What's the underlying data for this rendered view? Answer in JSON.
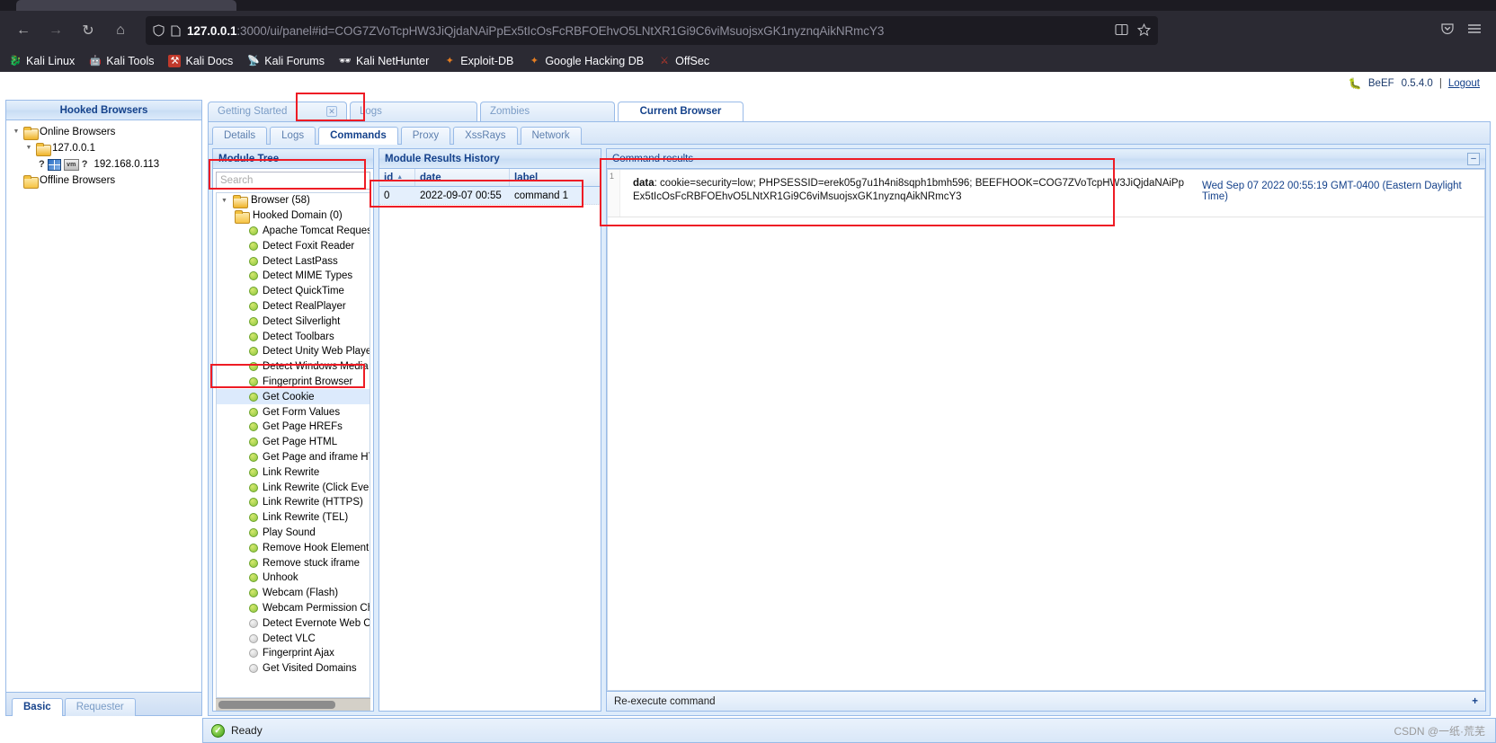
{
  "browser": {
    "nav": {
      "back_icon": "back-arrow-icon",
      "forward_icon": "forward-arrow-icon",
      "reload_icon": "reload-icon",
      "home_icon": "home-icon",
      "shield_icon": "shield-icon",
      "page_icon": "page-icon",
      "reader_icon": "reader-view-icon",
      "bookmark_icon": "star-icon",
      "pocket_icon": "pocket-icon",
      "menu_icon": "hamburger-menu-icon"
    },
    "url": {
      "host": "127.0.0.1",
      "rest": ":3000/ui/panel#id=COG7ZVoTcpHW3JiQjdaNAiPpEx5tIcOsFcRBFOEhvO5LNtXR1Gi9C6viMsuojsxGK1nyznqAikNRmcY3",
      "full": "127.0.0.1:3000/ui/panel#id=COG7ZVoTcpHW3JiQjdaNAiPpEx5tIcOsFcRBFOEhvO5LNtXR1Gi9C6viMsuojsxGK1nyznqAikNRmcY3"
    },
    "bookmarks": [
      {
        "label": "Kali Linux",
        "icon": "kali-dragon-icon"
      },
      {
        "label": "Kali Tools",
        "icon": "kali-tools-icon"
      },
      {
        "label": "Kali Docs",
        "icon": "kali-docs-icon"
      },
      {
        "label": "Kali Forums",
        "icon": "kali-forums-icon"
      },
      {
        "label": "Kali NetHunter",
        "icon": "kali-nethunter-icon"
      },
      {
        "label": "Exploit-DB",
        "icon": "exploit-db-icon"
      },
      {
        "label": "Google Hacking DB",
        "icon": "google-hacking-db-icon"
      },
      {
        "label": "OffSec",
        "icon": "offsec-icon"
      }
    ]
  },
  "app": {
    "brand": "BeEF",
    "version": "0.5.4.0",
    "separator": "|",
    "logout": "Logout",
    "logo_icon": "beef-bull-icon"
  },
  "hooked_browsers": {
    "title": "Hooked Browsers",
    "nodes": [
      {
        "label": "Online Browsers",
        "indent": 1,
        "type": "folder-open",
        "expander": "expanded"
      },
      {
        "label": "127.0.0.1",
        "indent": 2,
        "type": "folder-open",
        "expander": "expanded"
      },
      {
        "label": "192.168.0.113",
        "indent": 3,
        "type": "browser-entry"
      },
      {
        "label": "Offline Browsers",
        "indent": 1,
        "type": "folder",
        "expander": "none"
      }
    ],
    "tabs": [
      {
        "label": "Basic",
        "active": true
      },
      {
        "label": "Requester",
        "active": false
      }
    ]
  },
  "main_tabs": [
    {
      "label": "Getting Started",
      "active": false,
      "closable": true,
      "close_icon": "close-icon"
    },
    {
      "label": "Logs",
      "active": false,
      "closable": false
    },
    {
      "label": "Zombies",
      "active": false,
      "closable": false
    },
    {
      "label": "Current Browser",
      "active": true,
      "closable": false
    }
  ],
  "sub_tabs": [
    {
      "label": "Details",
      "active": false
    },
    {
      "label": "Logs",
      "active": false
    },
    {
      "label": "Commands",
      "active": true
    },
    {
      "label": "Proxy",
      "active": false
    },
    {
      "label": "XssRays",
      "active": false
    },
    {
      "label": "Network",
      "active": false
    }
  ],
  "module_tree": {
    "title": "Module Tree",
    "search_placeholder": "Search",
    "items": [
      {
        "label": "Browser (58)",
        "indent": 1,
        "node": "folder-open",
        "expander": "expanded"
      },
      {
        "label": "Hooked Domain (0)",
        "indent": 2,
        "node": "folder"
      },
      {
        "label": "Apache Tomcat RequestH",
        "indent": 3,
        "node": "green"
      },
      {
        "label": "Detect Foxit Reader",
        "indent": 3,
        "node": "green"
      },
      {
        "label": "Detect LastPass",
        "indent": 3,
        "node": "green"
      },
      {
        "label": "Detect MIME Types",
        "indent": 3,
        "node": "green"
      },
      {
        "label": "Detect QuickTime",
        "indent": 3,
        "node": "green"
      },
      {
        "label": "Detect RealPlayer",
        "indent": 3,
        "node": "green"
      },
      {
        "label": "Detect Silverlight",
        "indent": 3,
        "node": "green"
      },
      {
        "label": "Detect Toolbars",
        "indent": 3,
        "node": "green"
      },
      {
        "label": "Detect Unity Web Player",
        "indent": 3,
        "node": "green"
      },
      {
        "label": "Detect Windows Media Pl",
        "indent": 3,
        "node": "green"
      },
      {
        "label": "Fingerprint Browser",
        "indent": 3,
        "node": "green"
      },
      {
        "label": "Get Cookie",
        "indent": 3,
        "node": "green",
        "selected": true
      },
      {
        "label": "Get Form Values",
        "indent": 3,
        "node": "green"
      },
      {
        "label": "Get Page HREFs",
        "indent": 3,
        "node": "green"
      },
      {
        "label": "Get Page HTML",
        "indent": 3,
        "node": "green"
      },
      {
        "label": "Get Page and iframe HTM",
        "indent": 3,
        "node": "green"
      },
      {
        "label": "Link Rewrite",
        "indent": 3,
        "node": "green"
      },
      {
        "label": "Link Rewrite (Click Events",
        "indent": 3,
        "node": "green"
      },
      {
        "label": "Link Rewrite (HTTPS)",
        "indent": 3,
        "node": "green"
      },
      {
        "label": "Link Rewrite (TEL)",
        "indent": 3,
        "node": "green"
      },
      {
        "label": "Play Sound",
        "indent": 3,
        "node": "green"
      },
      {
        "label": "Remove Hook Element",
        "indent": 3,
        "node": "green"
      },
      {
        "label": "Remove stuck iframe",
        "indent": 3,
        "node": "green"
      },
      {
        "label": "Unhook",
        "indent": 3,
        "node": "green"
      },
      {
        "label": "Webcam (Flash)",
        "indent": 3,
        "node": "green"
      },
      {
        "label": "Webcam Permission Che",
        "indent": 3,
        "node": "green"
      },
      {
        "label": "Detect Evernote Web Clip",
        "indent": 3,
        "node": "grey"
      },
      {
        "label": "Detect VLC",
        "indent": 3,
        "node": "grey"
      },
      {
        "label": "Fingerprint Ajax",
        "indent": 3,
        "node": "grey"
      },
      {
        "label": "Get Visited Domains",
        "indent": 3,
        "node": "grey"
      }
    ]
  },
  "results_history": {
    "title": "Module Results History",
    "columns": [
      "id",
      "date",
      "label"
    ],
    "sort_icon": "sort-asc-icon",
    "rows": [
      {
        "id": "0",
        "date": "2022-09-07 00:55",
        "label": "command 1",
        "selected": true
      }
    ]
  },
  "command_results": {
    "title": "Command results",
    "collapse_icon": "collapse-icon",
    "entry_number": "1",
    "data_label": "data",
    "data_value": ": cookie=security=low; PHPSESSID=erek05g7u1h4ni8sqph1bmh596; BEEFHOOK=COG7ZVoTcpHW3JiQjdaNAiPpEx5tIcOsFcRBFOEhvO5LNtXR1Gi9C6viMsuojsxGK1nyznqAikNRmcY3",
    "timestamp": "Wed Sep 07 2022 00:55:19 GMT-0400 (Eastern Daylight Time)",
    "footer_label": "Re-execute command",
    "footer_plus": "+"
  },
  "status": {
    "icon": "check-circle-icon",
    "text": "Ready"
  },
  "watermark": "CSDN @一纸·荒芜"
}
